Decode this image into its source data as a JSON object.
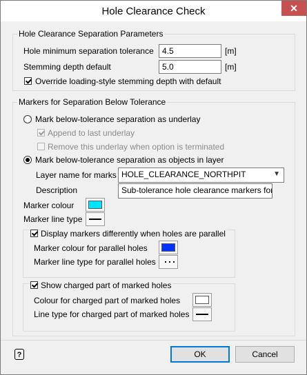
{
  "window": {
    "title": "Hole Clearance Check",
    "close_glyph": "✕"
  },
  "group_params": {
    "legend": "Hole Clearance Separation Parameters",
    "min_sep_label": "Hole minimum separation tolerance",
    "min_sep_value": "4.5",
    "min_sep_unit": "[m]",
    "stem_label": "Stemming depth default",
    "stem_value": "5.0",
    "stem_unit": "[m]",
    "override_label": "Override loading-style stemming depth with default",
    "override_checked": true
  },
  "group_markers": {
    "legend": "Markers for Separation Below Tolerance",
    "radio_underlay_label": "Mark below-tolerance separation as underlay",
    "append_label": "Append to last underlay",
    "remove_label": "Remove this underlay when option is terminated",
    "radio_objects_label": "Mark below-tolerance separation as objects in layer",
    "layer_label": "Layer name for marks",
    "layer_value": "HOLE_CLEARANCE_NORTHPIT",
    "desc_label": "Description",
    "desc_value": "Sub-tolerance hole clearance markers for",
    "marker_colour_label": "Marker colour",
    "marker_colour": "#00e5ff",
    "marker_line_label": "Marker line type",
    "parallel": {
      "label": "Display markers differently when holes are parallel",
      "checked": true,
      "colour_label": "Marker colour for parallel holes",
      "colour": "#0033ff",
      "line_label": "Marker line type for parallel holes"
    },
    "charged": {
      "label": "Show charged part of marked holes",
      "checked": true,
      "colour_label": "Colour for charged part of marked holes",
      "colour": "#ffffff",
      "line_label": "Line type for charged part of marked holes"
    }
  },
  "footer": {
    "help_glyph": "?",
    "ok_label": "OK",
    "cancel_label": "Cancel"
  }
}
